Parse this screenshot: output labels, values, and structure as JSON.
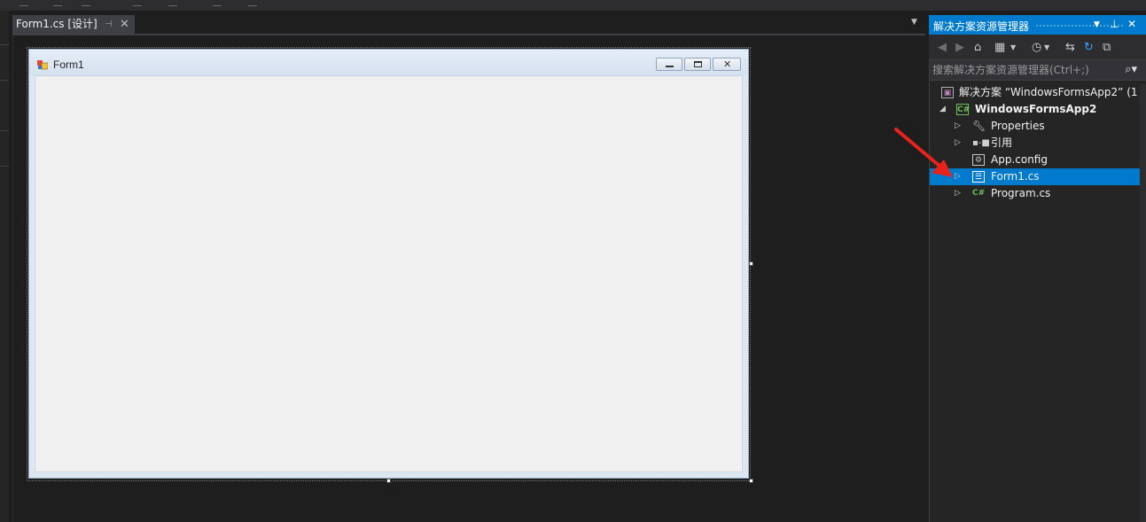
{
  "document_tab": {
    "title": "Form1.cs [设计]",
    "pin_icon": "pin-icon",
    "close_icon": "close-icon"
  },
  "form": {
    "title": "Form1",
    "icon": "winform-icon",
    "minimize_icon": "minimize-icon",
    "maximize_icon": "maximize-icon",
    "close_icon": "close-icon"
  },
  "solution_explorer": {
    "title": "解决方案资源管理器",
    "search_placeholder": "搜索解决方案资源管理器(Ctrl+;)",
    "toolbar_icons": [
      "back-icon",
      "forward-icon",
      "home-icon",
      "switch-views-icon",
      "pending-changes-icon",
      "sync-icon",
      "refresh-icon",
      "collapse-all-icon"
    ],
    "tree": [
      {
        "label": "解决方案 “WindowsFormsApp2” (1",
        "icon": "solution-icon",
        "level": 0,
        "expander": "",
        "bold": false
      },
      {
        "label": "WindowsFormsApp2",
        "icon": "csharp-project-icon",
        "level": 1,
        "expander": "expanded",
        "bold": true
      },
      {
        "label": "Properties",
        "icon": "wrench-icon",
        "level": 2,
        "expander": "collapsed",
        "bold": false
      },
      {
        "label": "引用",
        "icon": "references-icon",
        "level": 2,
        "expander": "collapsed",
        "bold": false
      },
      {
        "label": "App.config",
        "icon": "config-file-icon",
        "level": 2,
        "expander": "",
        "bold": false
      },
      {
        "label": "Form1.cs",
        "icon": "form-file-icon",
        "level": 2,
        "expander": "collapsed",
        "bold": false,
        "selected": true
      },
      {
        "label": "Program.cs",
        "icon": "csharp-file-icon",
        "level": 2,
        "expander": "collapsed",
        "bold": false
      }
    ]
  },
  "colors": {
    "accent": "#007acc",
    "background": "#1e1e1e",
    "arrow": "#e8231b"
  }
}
